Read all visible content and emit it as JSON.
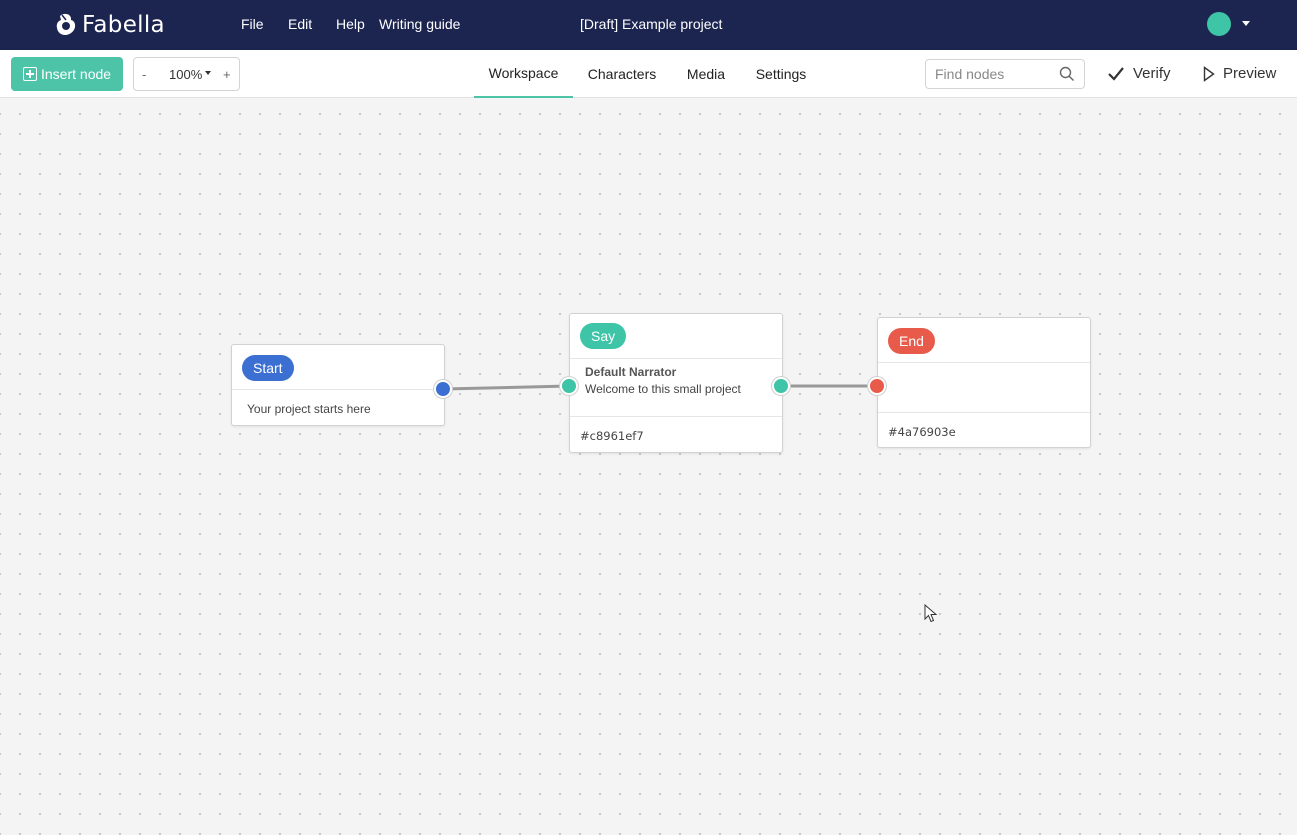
{
  "app": {
    "name": "Fabella"
  },
  "topbar": {
    "menu": [
      {
        "label": "File"
      },
      {
        "label": "Edit"
      },
      {
        "label": "Help"
      },
      {
        "label": "Writing guide"
      }
    ],
    "project_title": "[Draft] Example project",
    "avatar_color": "#3ec4a6",
    "background_color": "#1b2550"
  },
  "toolbar": {
    "insert_label": "Insert node",
    "zoom": {
      "minus": "-",
      "value": "100%",
      "plus": "+"
    },
    "tabs": [
      {
        "label": "Workspace",
        "active": true
      },
      {
        "label": "Characters",
        "active": false
      },
      {
        "label": "Media",
        "active": false
      },
      {
        "label": "Settings",
        "active": false
      }
    ],
    "search_placeholder": "Find nodes",
    "verify_label": "Verify",
    "preview_label": "Preview",
    "accent_color": "#4dc4a8"
  },
  "nodes": {
    "start": {
      "type_label": "Start",
      "text": "Your project starts here",
      "color": "#3b6fd1"
    },
    "say": {
      "type_label": "Say",
      "speaker": "Default Narrator",
      "text": "Welcome to this small project",
      "id": "#c8961ef7",
      "color": "#3ec4a6"
    },
    "end": {
      "type_label": "End",
      "id": "#4a76903e",
      "color": "#e85a4a"
    }
  },
  "icons": [
    "logo-icon",
    "plus-box-icon",
    "search-icon",
    "check-icon",
    "play-icon",
    "caret-down-icon",
    "cursor-icon"
  ]
}
